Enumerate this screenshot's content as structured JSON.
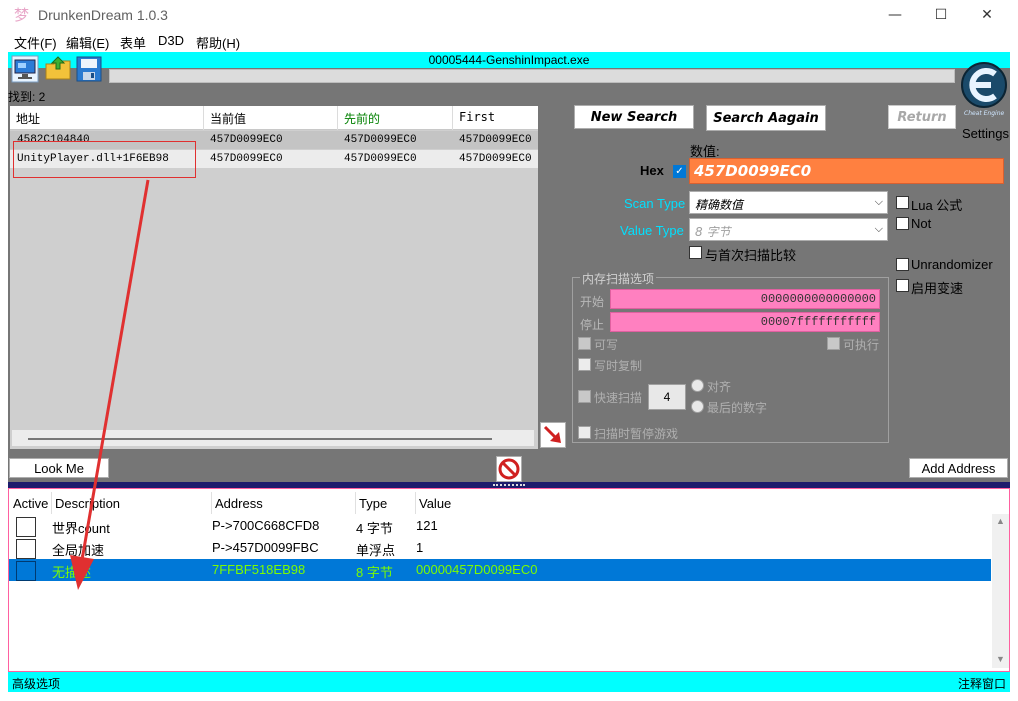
{
  "app": {
    "title": "DrunkenDream 1.0.3",
    "icon": "dream-icon"
  },
  "window_controls": {
    "minimize": "—",
    "maximize": "☐",
    "close": "✕"
  },
  "menu": [
    "文件(F)",
    "编辑(E)",
    "表单",
    "D3D",
    "帮助(H)"
  ],
  "process": "00005444-GenshinImpact.exe",
  "found": "找到: 2",
  "result_list": {
    "headers": [
      "地址",
      "当前值",
      "先前的",
      "First"
    ],
    "header_colors": {
      "previous": "#008000"
    },
    "rows": [
      {
        "address": "4582C104840",
        "current": "457D0099EC0",
        "previous": "457D0099EC0",
        "first": "457D0099EC0"
      },
      {
        "address": "UnityPlayer.dll+1F6EB98",
        "current": "457D0099EC0",
        "previous": "457D0099EC0",
        "first": "457D0099EC0"
      }
    ]
  },
  "buttons": {
    "new_search": "New Search",
    "search_again": "Search Aagain",
    "return": "Return",
    "look_me": "Look Me",
    "add_address": "Add Address"
  },
  "settings": "Settings",
  "logo_caption": "Cheat Engine",
  "scan": {
    "value_label": "数值:",
    "hex_label": "Hex",
    "value": "457D0099EC0",
    "scan_type_label": "Scan Type",
    "scan_type_value": "精确数值",
    "value_type_label": "Value Type",
    "value_type_value": "8 字节",
    "compare_first": "与首次扫描比较",
    "lua_formula": "Lua 公式",
    "not": "Not",
    "unrandomizer": "Unrandomizer",
    "speedhack": "启用变速"
  },
  "memory_options": {
    "title": "内存扫描选项",
    "start_label": "开始",
    "start_value": "0000000000000000",
    "stop_label": "停止",
    "stop_value": "00007fffffffffff",
    "writable": "可写",
    "executable": "可执行",
    "copy_on_write": "写时复制",
    "fast_scan": "快速扫描",
    "fast_scan_value": "4",
    "align": "对齐",
    "last_digits": "最后的数字",
    "pause_game": "扫描时暂停游戏"
  },
  "address_list": {
    "headers": [
      "Active",
      "Description",
      "Address",
      "Type",
      "Value"
    ],
    "rows": [
      {
        "description": "世界count",
        "address": "P->700C668CFD8",
        "type": "4 字节",
        "value": "121",
        "selected": false
      },
      {
        "description": "全局加速",
        "address": "P->457D0099FBC",
        "type": "单浮点",
        "value": "1",
        "selected": false
      },
      {
        "description": "无描述",
        "address": "7FFBF518EB98",
        "type": "8 字节",
        "value": "00000457D0099EC0",
        "selected": true
      }
    ]
  },
  "status": {
    "left": "高级选项",
    "right": "注释窗口"
  },
  "colors": {
    "accent_cyan": "#00ffff",
    "selected_row": "#0078d7",
    "selected_text": "#7cfc00",
    "value_input": "#ff8040",
    "pink_input": "#ff80c0",
    "annotation": "#e03030"
  }
}
